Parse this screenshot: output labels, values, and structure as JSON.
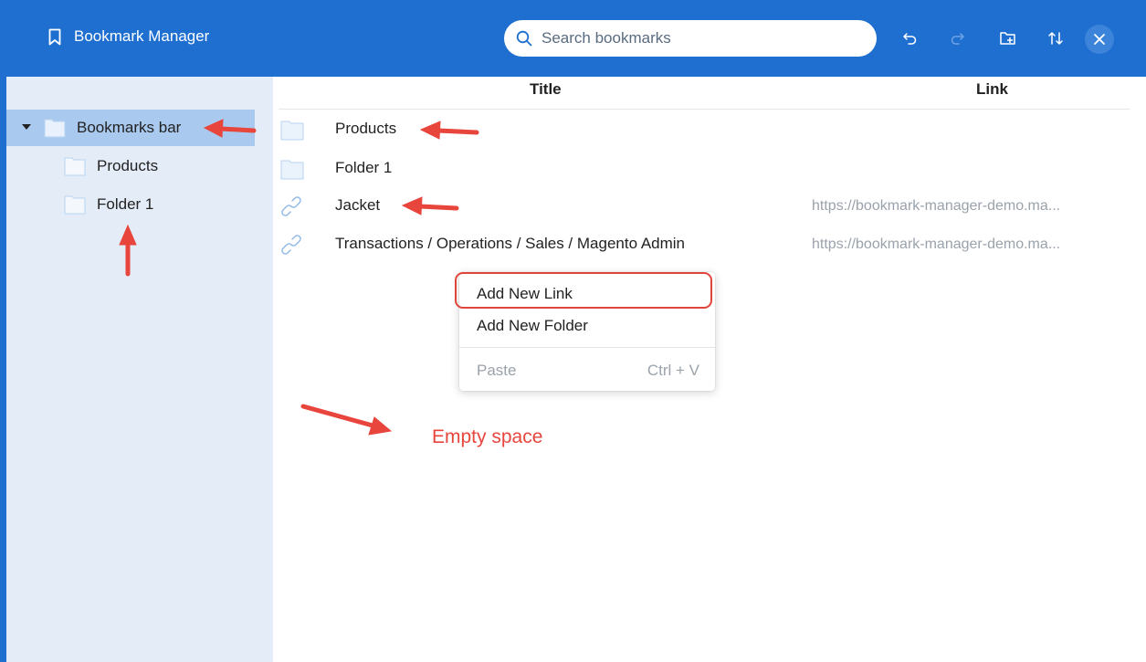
{
  "header": {
    "app_title": "Bookmark Manager",
    "search_placeholder": "Search bookmarks",
    "toolbar": {
      "undo_icon": "undo-icon",
      "redo_icon": "redo-icon",
      "new_folder_icon": "add-folder-icon",
      "sort_icon": "sort-icon",
      "close_icon": "close-icon"
    },
    "colors": {
      "bar": "#1e6fd0",
      "close_bg": "#3c84da"
    }
  },
  "sidebar": {
    "background": "#e4ecf8",
    "selected_color": "#a9c9ee",
    "tree": [
      {
        "label": "Bookmarks bar",
        "expanded": true,
        "selected": true,
        "level": 0
      },
      {
        "label": "Products",
        "level": 1
      },
      {
        "label": "Folder 1",
        "level": 1
      }
    ]
  },
  "table": {
    "columns": [
      "Title",
      "Link"
    ],
    "rows": [
      {
        "type": "folder",
        "title": "Products",
        "link": ""
      },
      {
        "type": "folder",
        "title": "Folder 1",
        "link": ""
      },
      {
        "type": "link",
        "title": "Jacket",
        "link": "https://bookmark-manager-demo.ma..."
      },
      {
        "type": "link",
        "title": "Transactions / Operations / Sales / Magento Admin",
        "link": "https://bookmark-manager-demo.ma..."
      }
    ]
  },
  "context_menu": {
    "items": [
      {
        "label": "Add New Link",
        "highlighted": true
      },
      {
        "label": "Add New Folder"
      },
      {
        "label": "Paste",
        "shortcut": "Ctrl + V",
        "disabled": true
      }
    ]
  },
  "annotations": {
    "empty_space_label": "Empty space",
    "color": "#e8453c"
  }
}
